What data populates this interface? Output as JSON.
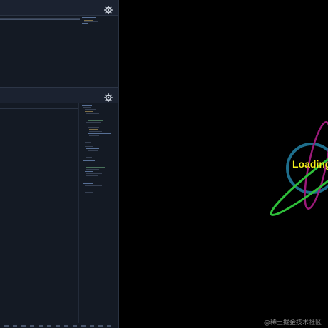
{
  "editor": {
    "top_panel": {
      "settings_icon": "gear-icon"
    },
    "bottom_panel": {
      "settings_icon": "gear-icon"
    }
  },
  "preview": {
    "loading_text": "Loading",
    "watermark_text": "@稀土掘金技术社区",
    "colors": {
      "background": "#000000",
      "text": "#f4f01a",
      "ring_blue": "#1e6e8c",
      "ring_magenta": "#9c1a7a",
      "ring_green": "#2fbf3a",
      "watermark": "#8c8c8c"
    }
  }
}
